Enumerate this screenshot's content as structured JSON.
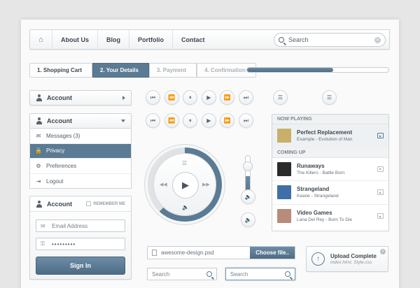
{
  "nav": {
    "home_icon": "⌂",
    "items": [
      {
        "label": "About Us"
      },
      {
        "label": "Blog"
      },
      {
        "label": "Portfolio"
      },
      {
        "label": "Contact"
      }
    ],
    "search_placeholder": "Search",
    "search_clear": "×"
  },
  "steps": [
    {
      "label": "1. Shopping Cart"
    },
    {
      "label": "2. Your Details"
    },
    {
      "label": "3. Payment"
    },
    {
      "label": "4. Confirmation"
    }
  ],
  "progress_fraction": 0.61,
  "account_collapsed": {
    "label": "Account"
  },
  "account_menu": {
    "label": "Account",
    "items": [
      {
        "icon": "✉",
        "label": "Messages (3)"
      },
      {
        "icon": "🔒",
        "label": "Privacy",
        "active": true
      },
      {
        "icon": "⚙",
        "label": "Preferences"
      },
      {
        "icon": "⇥",
        "label": "Logout"
      }
    ]
  },
  "login": {
    "title": "Account",
    "remember": "REMEMBER ME",
    "email_placeholder": "Email Address",
    "password_value": "•••••••••",
    "submit": "Sign In"
  },
  "media_controls": {
    "row1": [
      "⏮",
      "⏪",
      "⏸",
      "▶",
      "⏩",
      "⏭"
    ],
    "row2": [
      "⏮",
      "⏪",
      "⏸",
      "▶",
      "⏩",
      "⏭"
    ]
  },
  "big_player": {
    "play": "▶",
    "prev": "◀◀",
    "next": "▶▶",
    "list": "☰",
    "volume": "🔈",
    "progress_fraction": 0.62
  },
  "volume_level": 0.55,
  "volume_icons": {
    "a": "🔈",
    "b": "🔈"
  },
  "list_toggle_icons": {
    "a": "☰",
    "b": "☰"
  },
  "playlist": {
    "now_playing_label": "NOW PLAYING",
    "now_playing": {
      "title": "Perfect Replacement",
      "subtitle": "Example - Evolution of Man",
      "cover": "#c8b06a"
    },
    "coming_up_label": "COMING UP",
    "tracks": [
      {
        "title": "Runaways",
        "subtitle": "The Killers - Battle Born",
        "cover": "#2b2b2b"
      },
      {
        "title": "Strangeland",
        "subtitle": "Keane - Strangeland",
        "cover": "#3f6fa6"
      },
      {
        "title": "Video Games",
        "subtitle": "Lana Del Rey - Born To Die",
        "cover": "#b78c7a"
      }
    ],
    "play_icon": "▶"
  },
  "file_input": {
    "filename": "awesome-design.psd",
    "button": "Choose file.."
  },
  "search_boxes": [
    {
      "placeholder": "Search"
    },
    {
      "placeholder": "Search"
    }
  ],
  "upload": {
    "icon": "↑",
    "title": "Upload Complete",
    "subtitle": "index.html, Style.css",
    "close": "×"
  },
  "colors": {
    "accent": "#5b7b94",
    "accent_dark": "#4c6b84",
    "background": "#e6e6e6"
  }
}
